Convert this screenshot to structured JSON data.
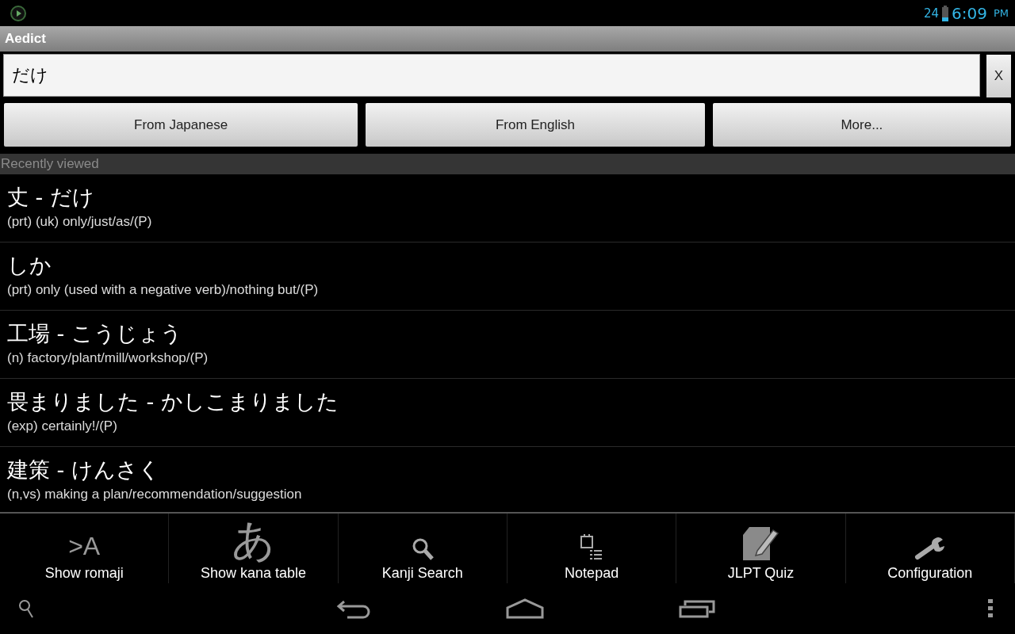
{
  "status_bar": {
    "battery_level_text": "24",
    "time": "6:09",
    "ampm": "PM"
  },
  "app_bar": {
    "title": "Aedict"
  },
  "search": {
    "value": "だけ",
    "clear_label": "X"
  },
  "buttons": [
    "From Japanese",
    "From English",
    "More..."
  ],
  "section_header": "Recently viewed",
  "entries": [
    {
      "term": "丈 - だけ",
      "meaning": "(prt) (uk) only/just/as/(P)"
    },
    {
      "term": "しか",
      "meaning": "(prt) only (used with a negative verb)/nothing but/(P)"
    },
    {
      "term": "工場 - こうじょう",
      "meaning": "(n) factory/plant/mill/workshop/(P)"
    },
    {
      "term": "畏まりました - かしこまりました",
      "meaning": "(exp) certainly!/(P)"
    },
    {
      "term": "建策 - けんさく",
      "meaning": "(n,vs) making a plan/recommendation/suggestion"
    }
  ],
  "menu": [
    {
      "kind": "glyph",
      "glyph": ">A",
      "label": "Show romaji"
    },
    {
      "kind": "glyph",
      "glyph": "あ",
      "label": "Show kana table"
    },
    {
      "kind": "search",
      "label": "Kanji Search"
    },
    {
      "kind": "notepad",
      "label": "Notepad"
    },
    {
      "kind": "quiz",
      "label": "JLPT Quiz"
    },
    {
      "kind": "wrench",
      "label": "Configuration"
    }
  ]
}
